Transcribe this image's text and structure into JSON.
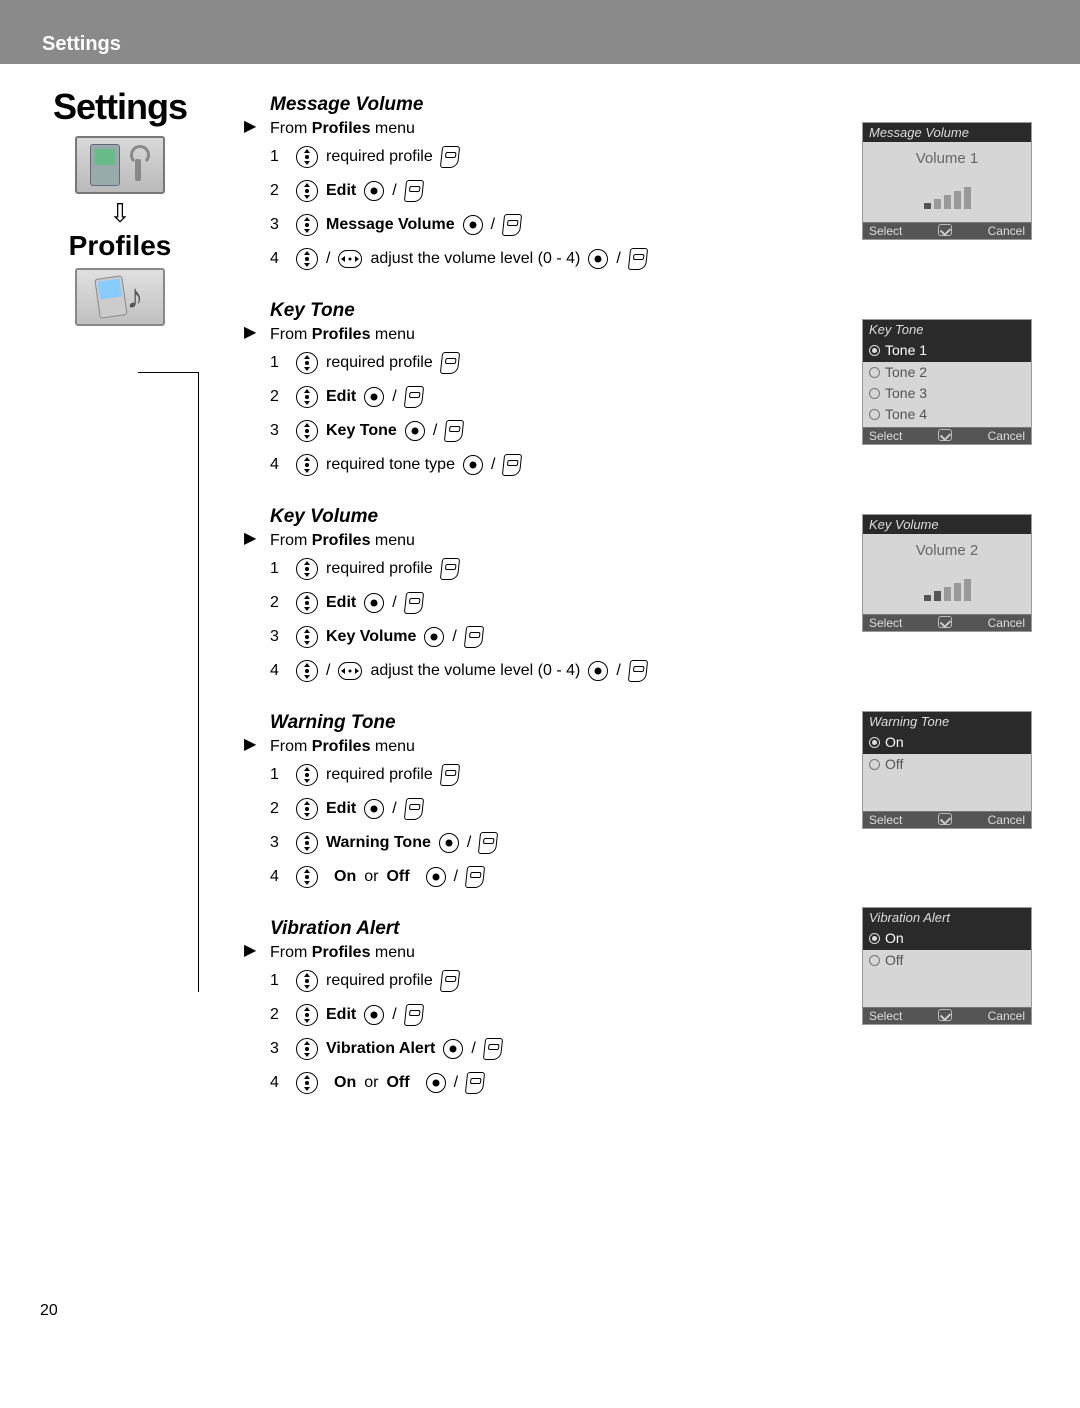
{
  "header": {
    "title": "Settings"
  },
  "sidebar": {
    "title": "Settings",
    "subtitle": "Profiles"
  },
  "common": {
    "from_prefix": "From ",
    "from_menu": "Profiles",
    "from_suffix": " menu",
    "required_profile": "required profile",
    "edit": "Edit",
    "adjust_volume": "adjust the volume level (0 - 4)",
    "required_tone_type": "required tone type",
    "on_or_off_on": "On",
    "on_or_off_or": " or ",
    "on_or_off_off": "Off",
    "slash": " / "
  },
  "sections": [
    {
      "title": "Message Volume",
      "step3_label": "Message Volume",
      "step4_type": "adjust"
    },
    {
      "title": "Key Tone",
      "step3_label": "Key Tone",
      "step4_type": "tone"
    },
    {
      "title": "Key Volume",
      "step3_label": "Key Volume",
      "step4_type": "adjust"
    },
    {
      "title": "Warning Tone",
      "step3_label": "Warning Tone",
      "step4_type": "onoff"
    },
    {
      "title": "Vibration Alert",
      "step3_label": "Vibration Alert",
      "step4_type": "onoff"
    }
  ],
  "mocks": {
    "message_volume": {
      "title": "Message Volume",
      "label": "Volume 1",
      "level": 1,
      "max": 5,
      "select": "Select",
      "cancel": "Cancel"
    },
    "key_tone": {
      "title": "Key Tone",
      "options": [
        "Tone 1",
        "Tone 2",
        "Tone 3",
        "Tone 4"
      ],
      "selected": 0,
      "select": "Select",
      "cancel": "Cancel"
    },
    "key_volume": {
      "title": "Key Volume",
      "label": "Volume 2",
      "level": 2,
      "max": 5,
      "select": "Select",
      "cancel": "Cancel"
    },
    "warning_tone": {
      "title": "Warning Tone",
      "options": [
        "On",
        "Off"
      ],
      "selected": 0,
      "select": "Select",
      "cancel": "Cancel"
    },
    "vibration_alert": {
      "title": "Vibration Alert",
      "options": [
        "On",
        "Off"
      ],
      "selected": 0,
      "select": "Select",
      "cancel": "Cancel"
    }
  },
  "page_number": "20"
}
